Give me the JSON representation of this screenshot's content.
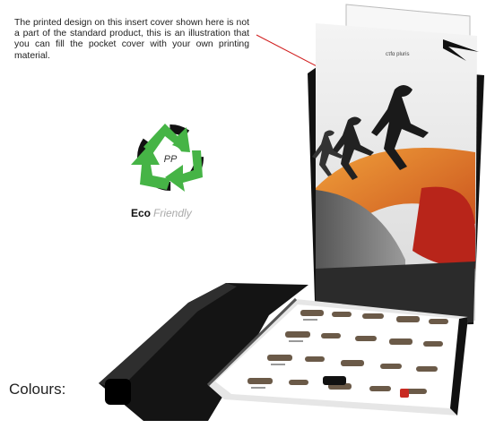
{
  "caption": {
    "text": "The printed design on this insert cover shown here is not a part of the standard product, this is an illustration that you can fill the pocket cover with your own printing material."
  },
  "eco_badge": {
    "center_text": "PP",
    "word_bold": "Eco",
    "word_light": "Friendly",
    "arrow_color": "#46b446",
    "dark_color": "#111111"
  },
  "cover_brand_text": "cτfα  pluris",
  "colours": {
    "label": "Colours:",
    "swatches": [
      {
        "name": "black",
        "color": "#000000"
      }
    ]
  }
}
